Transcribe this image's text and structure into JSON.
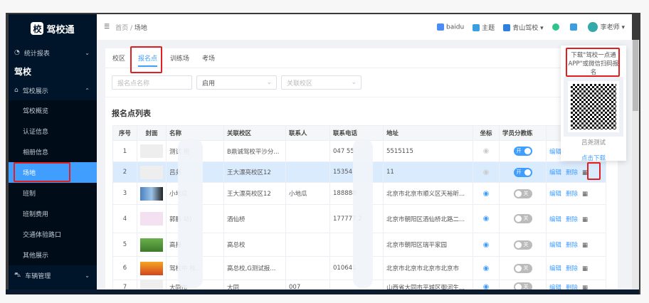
{
  "app": {
    "logo_char": "校",
    "logo_text": "驾校通"
  },
  "sidebar": {
    "stats": "统计报表",
    "section": "驾校",
    "group": "驾校展示",
    "items": [
      "驾校概览",
      "认证信息",
      "相册信息",
      "场地",
      "班制",
      "班制费用",
      "交通体验路口",
      "其他展示"
    ],
    "vehicle": "车辆管理"
  },
  "header": {
    "breadcrumb_home": "首页",
    "breadcrumb_sep": "/",
    "breadcrumb_current": "场地",
    "baidu": "baidu",
    "theme": "主题",
    "school": "青山驾校",
    "user": "李老师"
  },
  "tabs": [
    "校区",
    "报名点",
    "训练场",
    "考场"
  ],
  "filters": {
    "name_placeholder": "报名点名称",
    "status": "启用",
    "campus_placeholder": "关联校区"
  },
  "list_title": "报名点列表",
  "columns": [
    "序号",
    "封面",
    "名称",
    "关联校区",
    "联系人",
    "联系电话",
    "地址",
    "坐标",
    "学员分教练"
  ],
  "rows": [
    {
      "no": "1",
      "name": "测试      用",
      "campus": "B鼎诚驾校平沙分...",
      "contact": "",
      "phone": "047      55",
      "address": "5515115",
      "on": true,
      "switch": "开"
    },
    {
      "no": "2",
      "name": "吕尧",
      "campus": "王大漂亮校区12",
      "contact": "",
      "phone": "15354",
      "address": "11",
      "on": true,
      "switch": "开"
    },
    {
      "no": "3",
      "name": "小地瓜",
      "campus": "王大漂亮校区12",
      "contact": "小地瓜",
      "phone": "188888",
      "address": "北京市北京市顺义区天裕昕...",
      "on": false,
      "switch": "关"
    },
    {
      "no": "4",
      "name": "郭鹏      动)",
      "campus": "酒仙桥",
      "contact": "",
      "phone": "177777 2",
      "address": "北京市朝阳区酒仙桥北路二...",
      "on": false,
      "switch": "关"
    },
    {
      "no": "5",
      "name": "高报",
      "campus": "高总校",
      "contact": "",
      "phone": "",
      "address": "北京市朝阳区瑞平家园",
      "on": false,
      "switch": "关"
    },
    {
      "no": "6",
      "name": "驾校中      校...",
      "campus": "高总校,G测试报...",
      "contact": "",
      "phone": "010641",
      "address": "北京市北京市北京市北京市",
      "on": false,
      "switch": "关"
    },
    {
      "no": "7",
      "name": "大同市",
      "campus": "大同",
      "contact": "007",
      "phone": "",
      "address": "山西省大同市平城区御河生...",
      "on": false,
      "switch": "关"
    }
  ],
  "actions": {
    "edit": "编辑",
    "delete": "删除"
  },
  "popover": {
    "text": "下载\"驾校一点通APP\"或微信扫码报名",
    "qr_label": "吕尧测试",
    "download": "点击下载"
  },
  "colors": {
    "accent": "#409eff",
    "sidebar": "#001529",
    "highlight": "#e02020"
  }
}
